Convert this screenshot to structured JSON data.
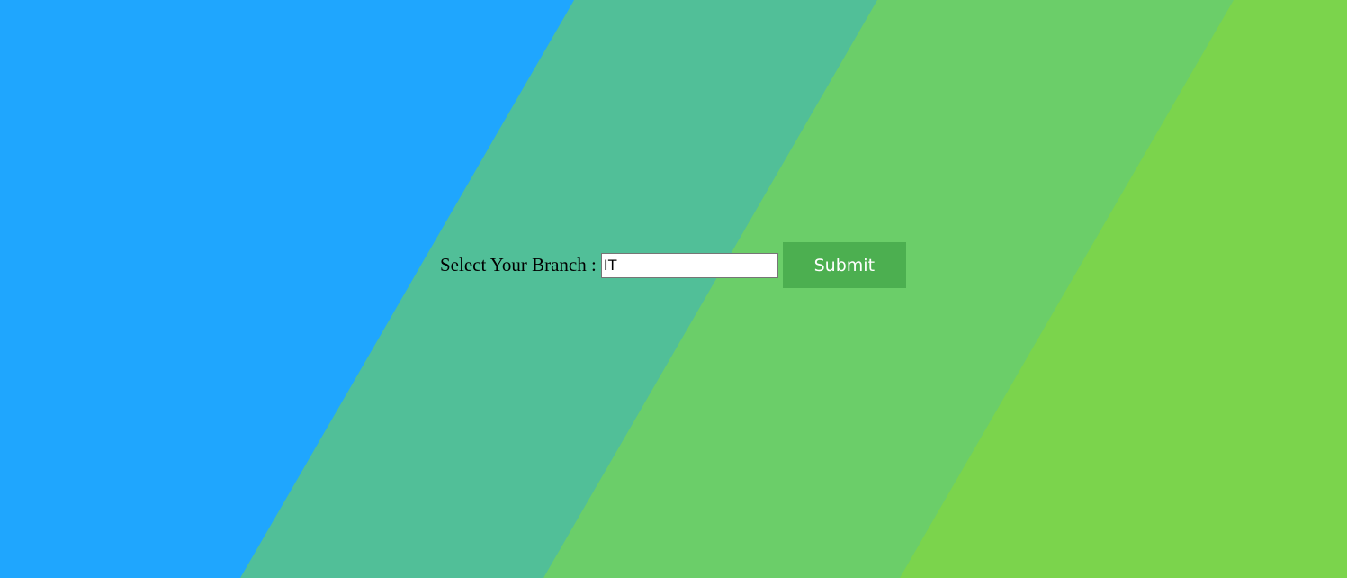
{
  "form": {
    "label": "Select Your Branch :",
    "input_value": "IT",
    "submit_label": "Submit"
  },
  "colors": {
    "stripe_blue": "#1fa6fe",
    "stripe_teal": "#51bf98",
    "stripe_green": "#6bce69",
    "stripe_lime": "#7bd44c",
    "button_bg": "#4caf50",
    "button_text": "#ffffff"
  }
}
